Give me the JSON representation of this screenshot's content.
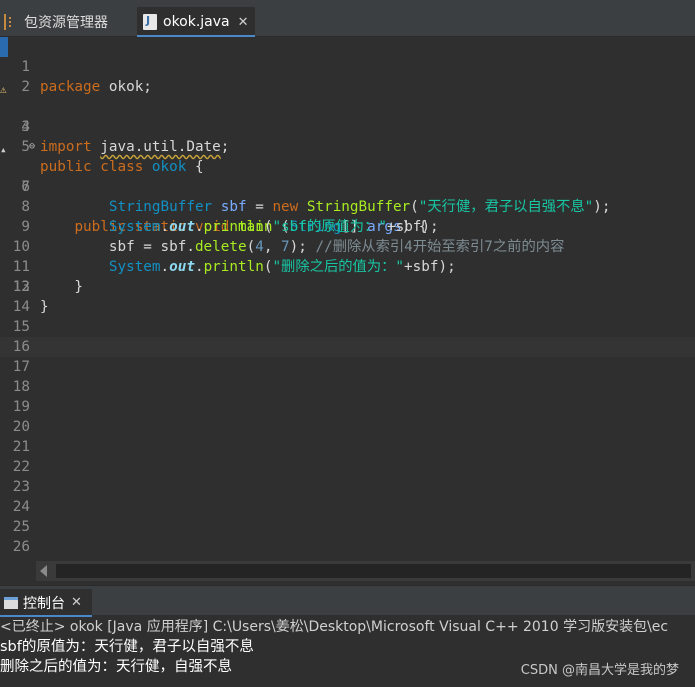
{
  "tabs": [
    {
      "label": "包资源管理器",
      "icon": "package-explorer-icon",
      "active": false
    },
    {
      "label": "okok.java",
      "icon": "java-file-icon",
      "active": true
    }
  ],
  "editor": {
    "current_line": 16,
    "lines": [
      {
        "n": "1"
      },
      {
        "n": "2"
      },
      {
        "n": "3"
      },
      {
        "n": "4"
      },
      {
        "n": "5"
      },
      {
        "n": "6"
      },
      {
        "n": "7"
      },
      {
        "n": "8"
      },
      {
        "n": "9"
      },
      {
        "n": "10"
      },
      {
        "n": "11"
      },
      {
        "n": "12"
      },
      {
        "n": "13"
      },
      {
        "n": "14"
      },
      {
        "n": "15"
      },
      {
        "n": "16"
      },
      {
        "n": "17"
      },
      {
        "n": "18"
      },
      {
        "n": "19"
      },
      {
        "n": "20"
      },
      {
        "n": "21"
      },
      {
        "n": "22"
      },
      {
        "n": "23"
      },
      {
        "n": "24"
      },
      {
        "n": "25"
      },
      {
        "n": "26"
      }
    ],
    "code": {
      "l1_kw": "package",
      "l1_rest": " okok;",
      "l3_kw": "import",
      "l3_pkg": "java.util.Date",
      "l3_end": ";",
      "l5_kw1": "public",
      "l5_kw2": "class",
      "l5_name": "okok",
      "l5_brace": " {",
      "l6_indent": "    ",
      "l6_kw1": "public",
      "l6_kw2": "static",
      "l6_kw3": "void",
      "l6_method": "main",
      "l6_open": " (",
      "l6_type": "String",
      "l6_arr": "[] ",
      "l6_arg": "args",
      "l6_close": ") {",
      "l7_indent": "        ",
      "l7_type": "StringBuffer",
      "l7_var": "sbf",
      "l7_eq": " = ",
      "l7_new": "new",
      "l7_ctor": "StringBuffer",
      "l7_open": "(",
      "l7_str": "\"天行健，君子以自强不息\"",
      "l7_close": ");",
      "l8_indent": "        ",
      "l8_sys": "System",
      "l8_dot1": ".",
      "l8_out": "out",
      "l8_dot2": ".",
      "l8_method": "println",
      "l8_open": "(",
      "l8_str": "\"sbf的原值为：\"",
      "l8_rest": "+sbf);",
      "l9_indent": "        ",
      "l9_code": "sbf = sbf.",
      "l9_method": "delete",
      "l9_open": "(",
      "l9_n1": "4",
      "l9_comma": ", ",
      "l9_n2": "7",
      "l9_close": "); ",
      "l9_comment": "//删除从索引4开始至索引7之前的内容",
      "l10_indent": "        ",
      "l10_sys": "System",
      "l10_dot1": ".",
      "l10_out": "out",
      "l10_dot2": ".",
      "l10_method": "println",
      "l10_open": "(",
      "l10_str": "\"删除之后的值为：\"",
      "l10_rest": "+sbf);",
      "l11": "    }",
      "l12": "}"
    }
  },
  "console": {
    "tab_label": "控制台",
    "status": "<已终止> okok [Java 应用程序] C:\\Users\\姜松\\Desktop\\Microsoft Visual C++ 2010 学习版安装包\\ec",
    "output": [
      "sbf的原值为：天行健，君子以自强不息",
      "删除之后的值为：天行健，自强不息"
    ]
  },
  "watermark": "CSDN @南昌大学是我的梦"
}
